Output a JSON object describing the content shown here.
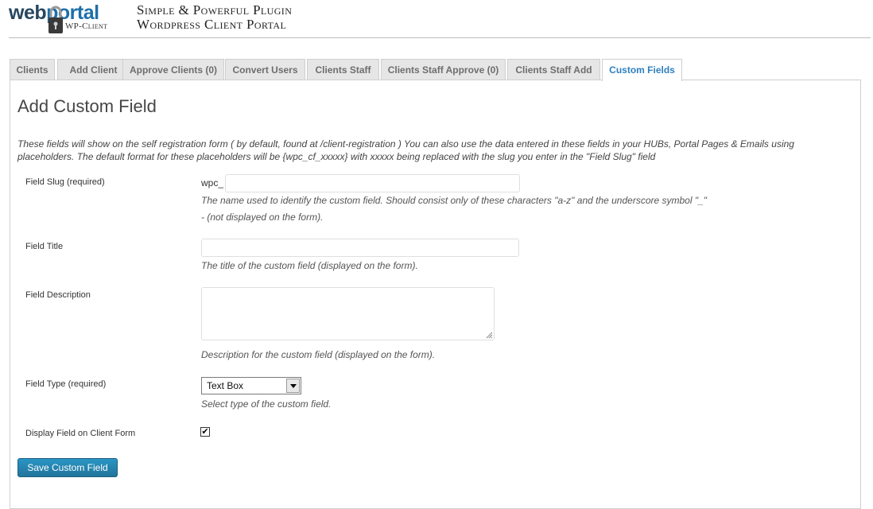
{
  "header": {
    "logo_part1": "web",
    "logo_part2": "portal",
    "logo_sub": "WP-Client",
    "tagline_line1": "Simple & Powerful Plugin",
    "tagline_line2": "Wordpress Client Portal"
  },
  "tabs": [
    {
      "label": "Clients",
      "active": false
    },
    {
      "label": "Add Client",
      "active": false
    },
    {
      "label": "Approve Clients (0)",
      "active": false
    },
    {
      "label": "Convert Users",
      "active": false
    },
    {
      "label": "Clients Staff",
      "active": false
    },
    {
      "label": "Clients Staff Approve (0)",
      "active": false
    },
    {
      "label": "Clients Staff Add",
      "active": false
    },
    {
      "label": "Custom Fields",
      "active": true
    }
  ],
  "page": {
    "title": "Add Custom Field",
    "intro_line1": "These fields will show on the self registration form ( by default, found at /client-registration ) You can also use the data entered in these fields in your HUBs, Portal Pages & Emails using",
    "intro_line2": "placeholders. The default format for these placeholders will be {wpc_cf_xxxxx} with xxxxx being replaced with the slug you enter in the \"Field Slug\" field"
  },
  "form": {
    "slug": {
      "label": "Field Slug (required)",
      "prefix": "wpc_",
      "value": "",
      "desc_line1": "The name used to identify the custom field. Should consist only of these characters \"a-z\" and the underscore symbol \"_\"",
      "desc_line2": "- (not displayed on the form)."
    },
    "title": {
      "label": "Field Title",
      "value": "",
      "desc": "The title of the custom field (displayed on the form)."
    },
    "description": {
      "label": "Field Description",
      "value": "",
      "desc": "Description for the custom field (displayed on the form)."
    },
    "type": {
      "label": "Field Type (required)",
      "selected": "Text Box",
      "desc": "Select type of the custom field."
    },
    "display": {
      "label": "Display Field on Client Form",
      "checked": true,
      "check_glyph": "✔"
    },
    "save_label": "Save Custom Field"
  },
  "colors": {
    "accent": "#21759b",
    "active_tab_text": "#2e7fc0",
    "logo_blue": "#1e6fa8"
  }
}
